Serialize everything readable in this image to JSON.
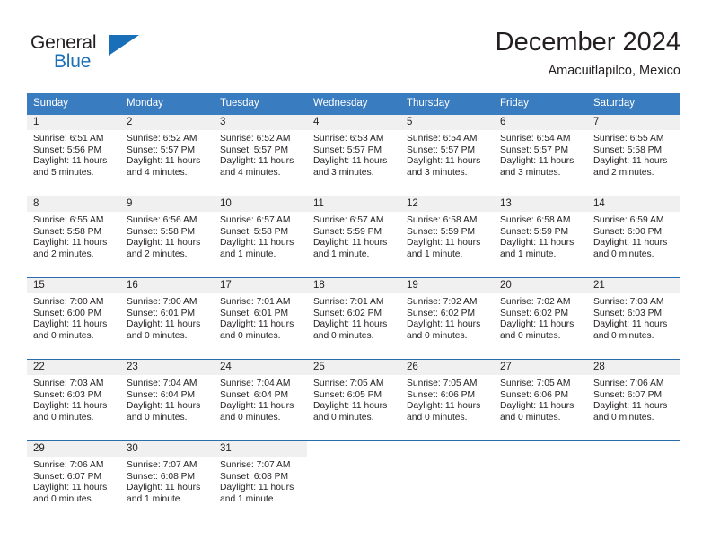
{
  "brand": {
    "line1": "General",
    "line2": "Blue",
    "flag_icon": "triangle-flag-icon",
    "accent_color": "#1a70b8"
  },
  "header": {
    "title": "December 2024",
    "subtitle": "Amacuitlapilco, Mexico"
  },
  "theme": {
    "header_bg": "#3a7cc0",
    "week_separator": "#2b6cad",
    "daynum_band": "#f0f0f0",
    "text": "#231f20"
  },
  "weekday_headers": [
    "Sunday",
    "Monday",
    "Tuesday",
    "Wednesday",
    "Thursday",
    "Friday",
    "Saturday"
  ],
  "weeks": [
    [
      {
        "day": "1",
        "sunrise": "Sunrise: 6:51 AM",
        "sunset": "Sunset: 5:56 PM",
        "daylight1": "Daylight: 11 hours",
        "daylight2": "and 5 minutes."
      },
      {
        "day": "2",
        "sunrise": "Sunrise: 6:52 AM",
        "sunset": "Sunset: 5:57 PM",
        "daylight1": "Daylight: 11 hours",
        "daylight2": "and 4 minutes."
      },
      {
        "day": "3",
        "sunrise": "Sunrise: 6:52 AM",
        "sunset": "Sunset: 5:57 PM",
        "daylight1": "Daylight: 11 hours",
        "daylight2": "and 4 minutes."
      },
      {
        "day": "4",
        "sunrise": "Sunrise: 6:53 AM",
        "sunset": "Sunset: 5:57 PM",
        "daylight1": "Daylight: 11 hours",
        "daylight2": "and 3 minutes."
      },
      {
        "day": "5",
        "sunrise": "Sunrise: 6:54 AM",
        "sunset": "Sunset: 5:57 PM",
        "daylight1": "Daylight: 11 hours",
        "daylight2": "and 3 minutes."
      },
      {
        "day": "6",
        "sunrise": "Sunrise: 6:54 AM",
        "sunset": "Sunset: 5:57 PM",
        "daylight1": "Daylight: 11 hours",
        "daylight2": "and 3 minutes."
      },
      {
        "day": "7",
        "sunrise": "Sunrise: 6:55 AM",
        "sunset": "Sunset: 5:58 PM",
        "daylight1": "Daylight: 11 hours",
        "daylight2": "and 2 minutes."
      }
    ],
    [
      {
        "day": "8",
        "sunrise": "Sunrise: 6:55 AM",
        "sunset": "Sunset: 5:58 PM",
        "daylight1": "Daylight: 11 hours",
        "daylight2": "and 2 minutes."
      },
      {
        "day": "9",
        "sunrise": "Sunrise: 6:56 AM",
        "sunset": "Sunset: 5:58 PM",
        "daylight1": "Daylight: 11 hours",
        "daylight2": "and 2 minutes."
      },
      {
        "day": "10",
        "sunrise": "Sunrise: 6:57 AM",
        "sunset": "Sunset: 5:58 PM",
        "daylight1": "Daylight: 11 hours",
        "daylight2": "and 1 minute."
      },
      {
        "day": "11",
        "sunrise": "Sunrise: 6:57 AM",
        "sunset": "Sunset: 5:59 PM",
        "daylight1": "Daylight: 11 hours",
        "daylight2": "and 1 minute."
      },
      {
        "day": "12",
        "sunrise": "Sunrise: 6:58 AM",
        "sunset": "Sunset: 5:59 PM",
        "daylight1": "Daylight: 11 hours",
        "daylight2": "and 1 minute."
      },
      {
        "day": "13",
        "sunrise": "Sunrise: 6:58 AM",
        "sunset": "Sunset: 5:59 PM",
        "daylight1": "Daylight: 11 hours",
        "daylight2": "and 1 minute."
      },
      {
        "day": "14",
        "sunrise": "Sunrise: 6:59 AM",
        "sunset": "Sunset: 6:00 PM",
        "daylight1": "Daylight: 11 hours",
        "daylight2": "and 0 minutes."
      }
    ],
    [
      {
        "day": "15",
        "sunrise": "Sunrise: 7:00 AM",
        "sunset": "Sunset: 6:00 PM",
        "daylight1": "Daylight: 11 hours",
        "daylight2": "and 0 minutes."
      },
      {
        "day": "16",
        "sunrise": "Sunrise: 7:00 AM",
        "sunset": "Sunset: 6:01 PM",
        "daylight1": "Daylight: 11 hours",
        "daylight2": "and 0 minutes."
      },
      {
        "day": "17",
        "sunrise": "Sunrise: 7:01 AM",
        "sunset": "Sunset: 6:01 PM",
        "daylight1": "Daylight: 11 hours",
        "daylight2": "and 0 minutes."
      },
      {
        "day": "18",
        "sunrise": "Sunrise: 7:01 AM",
        "sunset": "Sunset: 6:02 PM",
        "daylight1": "Daylight: 11 hours",
        "daylight2": "and 0 minutes."
      },
      {
        "day": "19",
        "sunrise": "Sunrise: 7:02 AM",
        "sunset": "Sunset: 6:02 PM",
        "daylight1": "Daylight: 11 hours",
        "daylight2": "and 0 minutes."
      },
      {
        "day": "20",
        "sunrise": "Sunrise: 7:02 AM",
        "sunset": "Sunset: 6:02 PM",
        "daylight1": "Daylight: 11 hours",
        "daylight2": "and 0 minutes."
      },
      {
        "day": "21",
        "sunrise": "Sunrise: 7:03 AM",
        "sunset": "Sunset: 6:03 PM",
        "daylight1": "Daylight: 11 hours",
        "daylight2": "and 0 minutes."
      }
    ],
    [
      {
        "day": "22",
        "sunrise": "Sunrise: 7:03 AM",
        "sunset": "Sunset: 6:03 PM",
        "daylight1": "Daylight: 11 hours",
        "daylight2": "and 0 minutes."
      },
      {
        "day": "23",
        "sunrise": "Sunrise: 7:04 AM",
        "sunset": "Sunset: 6:04 PM",
        "daylight1": "Daylight: 11 hours",
        "daylight2": "and 0 minutes."
      },
      {
        "day": "24",
        "sunrise": "Sunrise: 7:04 AM",
        "sunset": "Sunset: 6:04 PM",
        "daylight1": "Daylight: 11 hours",
        "daylight2": "and 0 minutes."
      },
      {
        "day": "25",
        "sunrise": "Sunrise: 7:05 AM",
        "sunset": "Sunset: 6:05 PM",
        "daylight1": "Daylight: 11 hours",
        "daylight2": "and 0 minutes."
      },
      {
        "day": "26",
        "sunrise": "Sunrise: 7:05 AM",
        "sunset": "Sunset: 6:06 PM",
        "daylight1": "Daylight: 11 hours",
        "daylight2": "and 0 minutes."
      },
      {
        "day": "27",
        "sunrise": "Sunrise: 7:05 AM",
        "sunset": "Sunset: 6:06 PM",
        "daylight1": "Daylight: 11 hours",
        "daylight2": "and 0 minutes."
      },
      {
        "day": "28",
        "sunrise": "Sunrise: 7:06 AM",
        "sunset": "Sunset: 6:07 PM",
        "daylight1": "Daylight: 11 hours",
        "daylight2": "and 0 minutes."
      }
    ],
    [
      {
        "day": "29",
        "sunrise": "Sunrise: 7:06 AM",
        "sunset": "Sunset: 6:07 PM",
        "daylight1": "Daylight: 11 hours",
        "daylight2": "and 0 minutes."
      },
      {
        "day": "30",
        "sunrise": "Sunrise: 7:07 AM",
        "sunset": "Sunset: 6:08 PM",
        "daylight1": "Daylight: 11 hours",
        "daylight2": "and 1 minute."
      },
      {
        "day": "31",
        "sunrise": "Sunrise: 7:07 AM",
        "sunset": "Sunset: 6:08 PM",
        "daylight1": "Daylight: 11 hours",
        "daylight2": "and 1 minute."
      },
      {
        "day": "",
        "sunrise": "",
        "sunset": "",
        "daylight1": "",
        "daylight2": ""
      },
      {
        "day": "",
        "sunrise": "",
        "sunset": "",
        "daylight1": "",
        "daylight2": ""
      },
      {
        "day": "",
        "sunrise": "",
        "sunset": "",
        "daylight1": "",
        "daylight2": ""
      },
      {
        "day": "",
        "sunrise": "",
        "sunset": "",
        "daylight1": "",
        "daylight2": ""
      }
    ]
  ]
}
